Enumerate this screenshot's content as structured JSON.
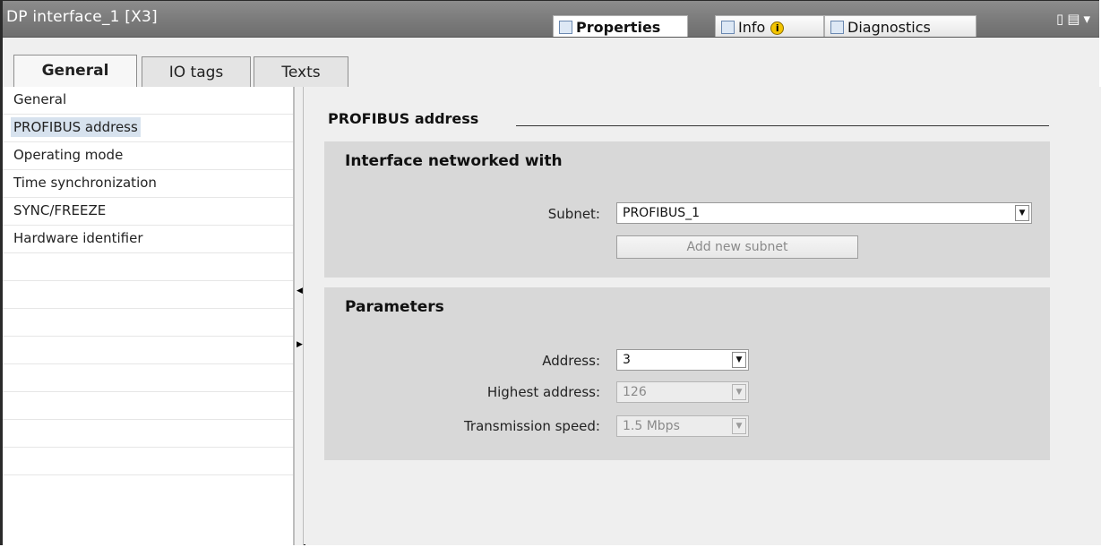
{
  "window": {
    "title": "DP interface_1 [X3]",
    "tabs": [
      {
        "label": "Properties",
        "icon": "properties-icon",
        "active": true
      },
      {
        "label": "Info",
        "icon": "info-icon",
        "badge": "i"
      },
      {
        "label": "Diagnostics",
        "icon": "diagnostics-icon"
      }
    ],
    "controls": "▯▤▾"
  },
  "inspector_tabs": [
    {
      "label": "General",
      "active": true
    },
    {
      "label": "IO tags"
    },
    {
      "label": "Texts"
    }
  ],
  "nav": {
    "items": [
      {
        "label": "General"
      },
      {
        "label": "PROFIBUS address",
        "selected": true
      },
      {
        "label": "Operating mode"
      },
      {
        "label": "Time synchronization"
      },
      {
        "label": "SYNC/FREEZE"
      },
      {
        "label": "Hardware identifier"
      }
    ]
  },
  "content": {
    "section_title": "PROFIBUS address",
    "networked": {
      "heading": "Interface networked with",
      "subnet_label": "Subnet:",
      "subnet_value": "PROFIBUS_1",
      "add_subnet_button": "Add new subnet"
    },
    "parameters": {
      "heading": "Parameters",
      "address_label": "Address:",
      "address_value": "3",
      "highest_label": "Highest address:",
      "highest_value": "126",
      "speed_label": "Transmission speed:",
      "speed_value": "1.5 Mbps"
    }
  },
  "colors": {
    "titlebar": "#7a7a7a",
    "selection": "#d7e2ee",
    "panel": "#d8d8d8"
  }
}
